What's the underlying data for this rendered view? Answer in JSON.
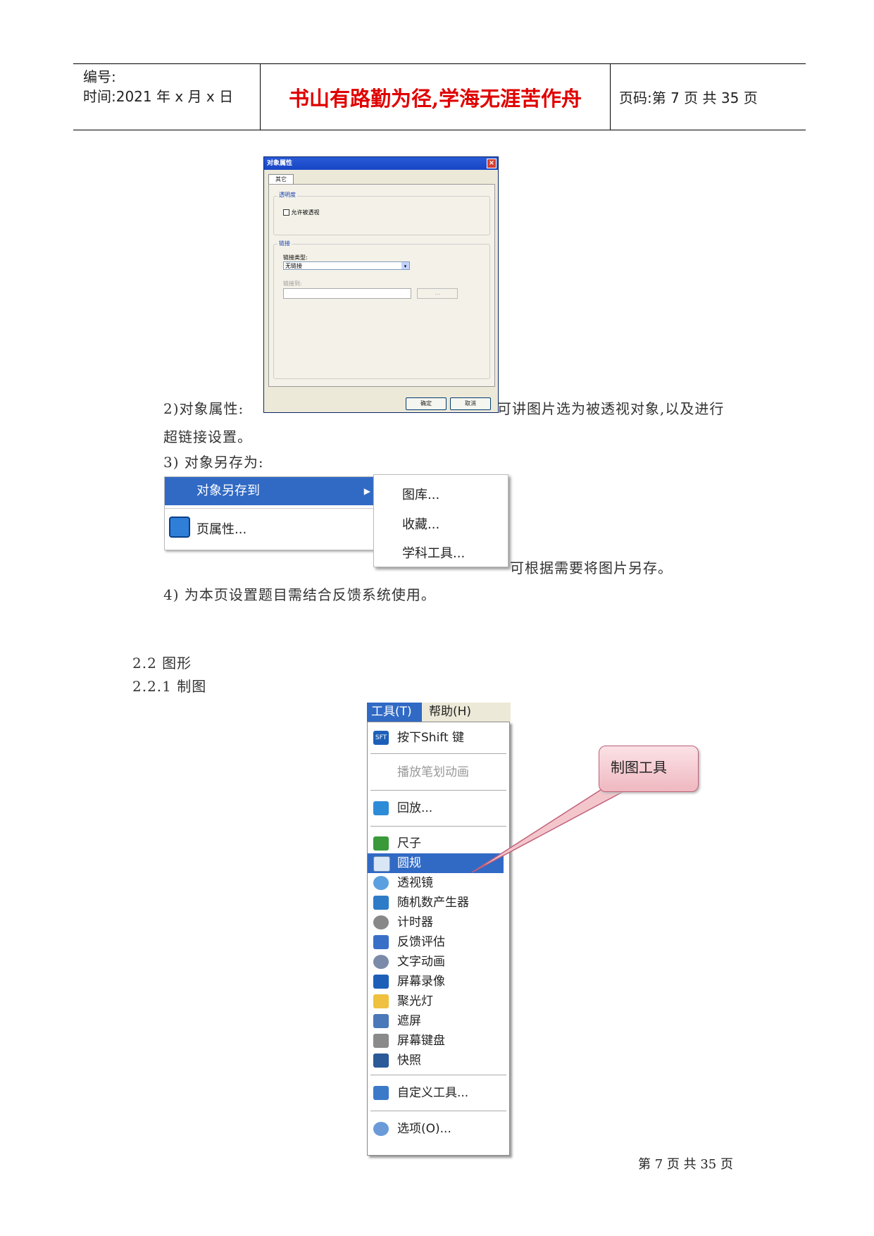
{
  "header": {
    "code_label": "编号:",
    "time_label": "时间:2021 年 x 月 x 日",
    "motto": "书山有路勤为径,学海无涯苦作舟",
    "page_label": "页码:第 7 页 共 35 页"
  },
  "body": {
    "item2_prefix": "2)对象属性:",
    "item2_suffix": "可讲图片选为被透视对象,以及进行",
    "item2_cont": "超链接设置。",
    "item3": "3) 对象另存为:",
    "item3_suffix": "可根据需要将图片另存。",
    "item4": "4) 为本页设置题目需结合反馈系统使用。",
    "sec22": "2.2 图形",
    "sec221": "2.2.1 制图"
  },
  "dialog": {
    "title": "对象属性",
    "tab": "其它",
    "group1": "透明度",
    "checkbox": "允许被透视",
    "group2": "链接",
    "link_type_label": "链接类型:",
    "link_type_value": "无链接",
    "link_to_label": "链接到:",
    "browse": "...",
    "ok": "确定",
    "cancel": "取消"
  },
  "context_menu": {
    "save_to": "对象另存到",
    "page_props": "页属性...",
    "submenu": [
      "图库...",
      "收藏...",
      "学科工具..."
    ]
  },
  "tools_menu": {
    "menubar": [
      "工具(T)",
      "帮助(H)"
    ],
    "shift": "按下Shift 键",
    "play_stroke": "播放笔划动画",
    "replay": "回放...",
    "items": [
      "尺子",
      "圆规",
      "透视镜",
      "随机数产生器",
      "计时器",
      "反馈评估",
      "文字动画",
      "屏幕录像",
      "聚光灯",
      "遮屏",
      "屏幕键盘",
      "快照"
    ],
    "custom": "自定义工具...",
    "options": "选项(O)..."
  },
  "callout": "制图工具",
  "footer": "第 7 页 共 35 页",
  "colors": {
    "motto": "#e00000",
    "menu_highlight": "#316ac5",
    "callout": "#f3c6cc"
  }
}
